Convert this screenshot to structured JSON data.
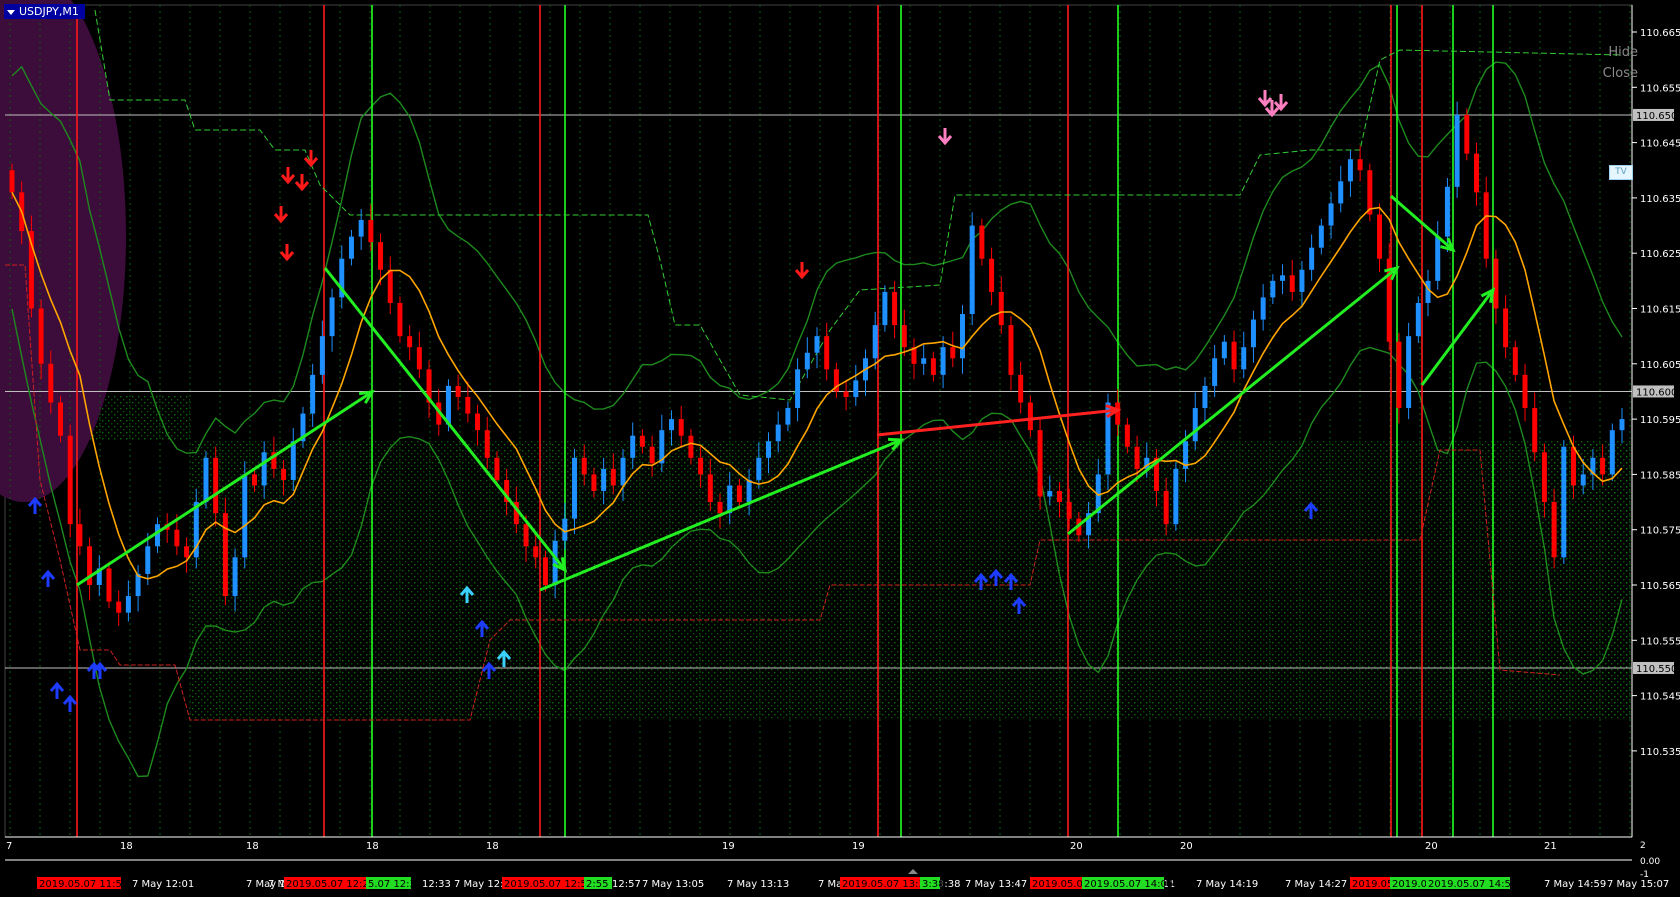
{
  "window": {
    "title": "USDJPY,M1"
  },
  "panel": {
    "hide_label": "Hide",
    "close_label": "Close",
    "tv_label": "TV"
  },
  "colors": {
    "background": "#000000",
    "bull": "#1e90ff",
    "bear": "#ff0000",
    "green_band": "#1e8a1e",
    "ma": "#ffa500",
    "trend_arrow": "#22ee22",
    "vline_red": "#ff1a1a",
    "vline_green": "#22ff22"
  },
  "price_axis": {
    "ticks": [
      "110.665",
      "110.655",
      "110.645",
      "110.635",
      "110.625",
      "110.615",
      "110.605",
      "110.595",
      "110.585",
      "110.575",
      "110.565",
      "110.555",
      "110.545",
      "110.535"
    ],
    "highlights": [
      "110.650",
      "110.600",
      "110.550"
    ],
    "sub_labels": [
      "2",
      "0.00",
      "-1"
    ]
  },
  "time_axis": {
    "labels": [
      "7",
      "18",
      "7 May 12:01",
      "18",
      "7 May 12:09",
      "7 May",
      "18",
      "12:33",
      "7 May 12:4",
      "18",
      "12:57",
      "7 May 13:05",
      "19",
      "7 May 13:13",
      "7 May 13:22",
      "19",
      "3:38",
      "7 May 13:47",
      "20",
      "7 May 14:11",
      "20",
      "7 May 14:19",
      "7 May 14:27",
      "20",
      "21",
      "7 May 14:59",
      "7 May 15:07"
    ],
    "red_tags": [
      "2019.05.07 11:54",
      "2019.05.07 12:21",
      "2019.05.07 12:51",
      "2019.05.07 13:35",
      "2019.05.07",
      "2019.05.07 1"
    ],
    "green_tags": [
      "5.07 12:31",
      "2:55",
      "2019.05.07 14:06",
      "2019.05.",
      "2019.05.07 14:53"
    ]
  },
  "chart_data": {
    "type": "candlestick",
    "symbol": "USDJPY",
    "timeframe": "M1",
    "ylim": [
      110.53,
      110.668
    ],
    "closes": [
      110.636,
      110.629,
      110.615,
      110.605,
      110.598,
      110.592,
      110.576,
      110.572,
      110.565,
      110.568,
      110.562,
      110.56,
      110.563,
      110.567,
      110.572,
      110.576,
      110.575,
      110.572,
      110.57,
      110.58,
      110.588,
      110.578,
      110.563,
      110.57,
      110.585,
      110.583,
      110.589,
      110.586,
      110.584,
      110.591,
      110.596,
      110.603,
      110.61,
      110.617,
      110.624,
      110.628,
      110.631,
      110.627,
      110.622,
      110.616,
      110.61,
      110.608,
      110.604,
      110.598,
      110.594,
      110.601,
      110.599,
      110.596,
      110.593,
      110.588,
      110.584,
      110.58,
      110.576,
      110.572,
      110.57,
      110.565,
      110.573,
      110.577,
      110.588,
      110.585,
      110.582,
      110.586,
      110.583,
      110.588,
      110.592,
      110.59,
      110.587,
      110.593,
      110.595,
      110.592,
      110.588,
      110.585,
      110.58,
      110.578,
      110.583,
      110.58,
      110.584,
      110.588,
      110.591,
      110.594,
      110.597,
      110.604,
      110.607,
      110.61,
      110.604,
      110.6,
      110.599,
      110.602,
      110.606,
      110.612,
      110.618,
      110.612,
      110.608,
      110.605,
      110.606,
      110.603,
      110.608,
      110.606,
      110.614,
      110.63,
      110.624,
      110.618,
      110.612,
      110.603,
      110.598,
      110.593,
      110.581,
      110.582,
      110.58,
      110.577,
      110.574,
      110.578,
      110.585,
      110.598,
      110.594,
      110.59,
      110.586,
      110.588,
      110.582,
      110.576,
      110.586,
      110.591,
      110.597,
      110.601,
      110.606,
      110.609,
      110.604,
      110.608,
      110.613,
      110.617,
      110.62,
      110.621,
      110.618,
      110.622,
      110.626,
      110.63,
      110.634,
      110.638,
      110.642,
      110.64,
      110.632,
      110.624,
      110.609,
      110.597,
      110.61,
      110.616,
      110.62,
      110.628,
      110.637,
      110.65,
      110.643,
      110.636,
      110.624,
      110.615,
      110.608,
      110.603,
      110.597,
      110.589,
      110.58,
      110.57,
      110.59,
      110.583,
      110.585,
      110.588,
      110.585,
      110.593,
      110.595
    ]
  },
  "markers": {
    "down_red": [
      [
        287,
        253
      ],
      [
        281,
        215
      ],
      [
        288,
        176
      ],
      [
        302,
        183
      ],
      [
        311,
        159
      ],
      [
        802,
        271
      ]
    ],
    "down_pink": [
      [
        945,
        137
      ],
      [
        1265,
        99
      ],
      [
        1272,
        109
      ],
      [
        1281,
        103
      ]
    ],
    "up_blue": [
      [
        35,
        505
      ],
      [
        48,
        578
      ],
      [
        57,
        690
      ],
      [
        70,
        703
      ],
      [
        94,
        670
      ],
      [
        100,
        670
      ],
      [
        482,
        628
      ],
      [
        489,
        670
      ],
      [
        981,
        581
      ],
      [
        996,
        577
      ],
      [
        1011,
        581
      ],
      [
        1019,
        605
      ],
      [
        1311,
        510
      ]
    ],
    "up_cyan": [
      [
        467,
        594
      ],
      [
        504,
        658
      ]
    ]
  }
}
